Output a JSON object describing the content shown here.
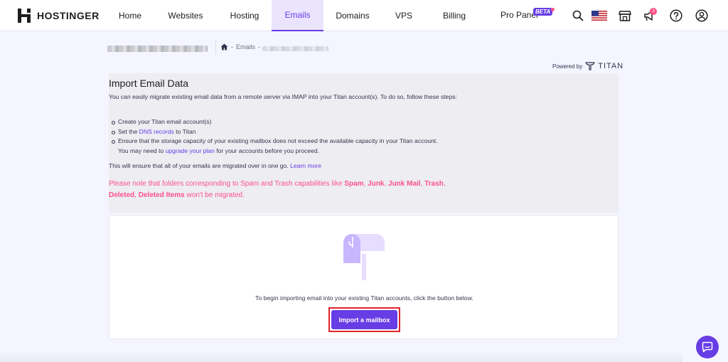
{
  "brand": {
    "name": "HOSTINGER"
  },
  "nav": {
    "items": [
      {
        "label": "Home",
        "active": false
      },
      {
        "label": "Websites",
        "active": false
      },
      {
        "label": "Hosting",
        "active": false
      },
      {
        "label": "Emails",
        "active": true
      },
      {
        "label": "Domains",
        "active": false
      },
      {
        "label": "VPS",
        "active": false
      },
      {
        "label": "Billing",
        "active": false
      }
    ],
    "pro_panel": "Pro Panel",
    "beta_badge": "BETA",
    "notification_count": "3",
    "icons": [
      "search-icon",
      "us-flag-icon",
      "store-icon",
      "megaphone-icon",
      "help-icon",
      "account-icon"
    ]
  },
  "breadcrumb": {
    "separator": "-",
    "section": "Emails"
  },
  "powered_by": {
    "label": "Powered by",
    "brand": "TITAN"
  },
  "import": {
    "title": "Import Email Data",
    "description": "You can easily migrate existing email data from a remote server via IMAP into your Titan account(s). To do so, follow these steps:",
    "steps": {
      "step1": "Create your Titan email account(s)",
      "step2_pre": "Set the ",
      "step2_link": "DNS records",
      "step2_post": " to Titan",
      "step3": "Ensure that the storage capacity of your existing mailbox does not exceed the available capacity in your Titan account.",
      "step3b_pre": "You may need to ",
      "step3b_link": "upgrade your plan",
      "step3b_post": " for your accounts before you proceed."
    },
    "ensure_text": "This will ensure that all of your emails are migrated over in one go.",
    "learn_more": "Learn more",
    "warning": {
      "pre": "Please note that folders corresponding to Spam and Trash capabilities like ",
      "spam": "Spam",
      "junk": "Junk",
      "junk_mail": "Junk Mail",
      "trash": "Trash",
      "deleted": "Deleted",
      "deleted_items": "Deleted Items",
      "post": " won't be migrated.",
      "comma": ", "
    }
  },
  "card": {
    "prompt": "To begin importing email into your existing Titan accounts, click the button below.",
    "button_label": "Import a mailbox"
  },
  "colors": {
    "accent": "#673de6",
    "warning": "#fc5185",
    "highlight_box": "#e0242b"
  }
}
